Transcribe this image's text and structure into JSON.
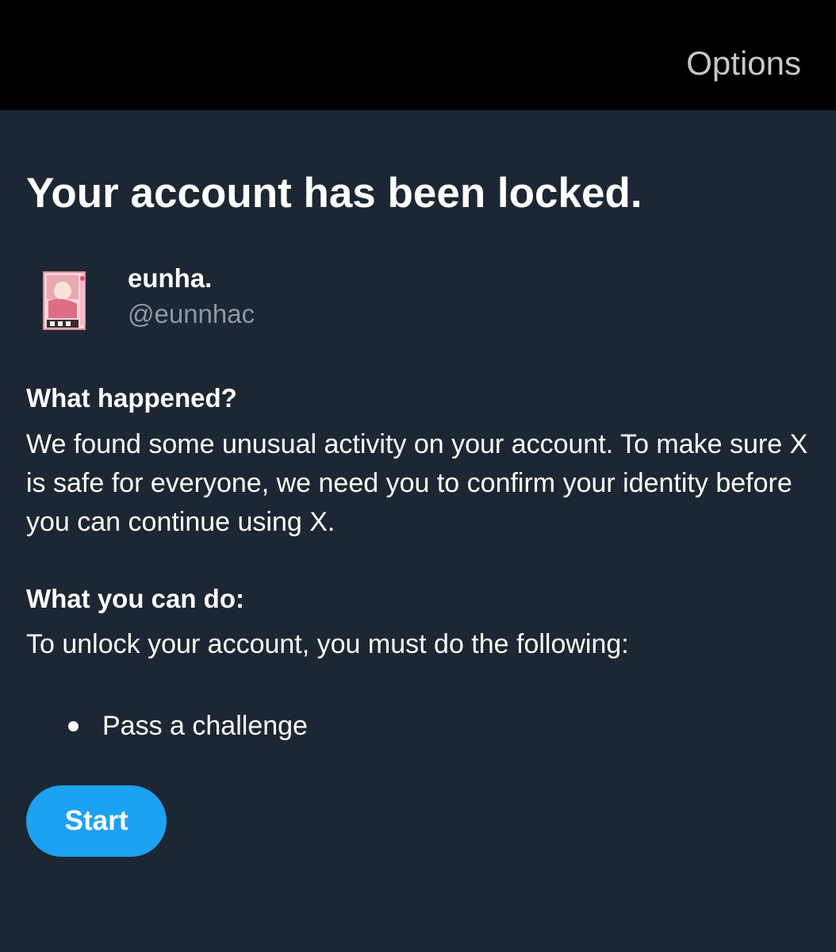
{
  "header": {
    "options_label": "Options"
  },
  "main": {
    "title": "Your account has been locked.",
    "account": {
      "display_name": "eunha.",
      "handle": "@eunnhac"
    },
    "what_happened": {
      "heading": "What happened?",
      "body": "We found some unusual activity on your account. To make sure X is safe for everyone, we need you to confirm your identity before you can continue using X."
    },
    "what_you_can_do": {
      "heading": "What you can do:",
      "body": "To unlock your account, you must do the following:",
      "steps": [
        "Pass a challenge"
      ]
    },
    "start_button_label": "Start"
  },
  "colors": {
    "header_bg": "#000000",
    "page_bg": "#1c2733",
    "primary_text": "#ffffff",
    "secondary_text": "#8b98a5",
    "options_text": "#c8c8c8",
    "accent": "#1da1f2"
  },
  "icons": {
    "avatar": "profile-avatar-image"
  }
}
